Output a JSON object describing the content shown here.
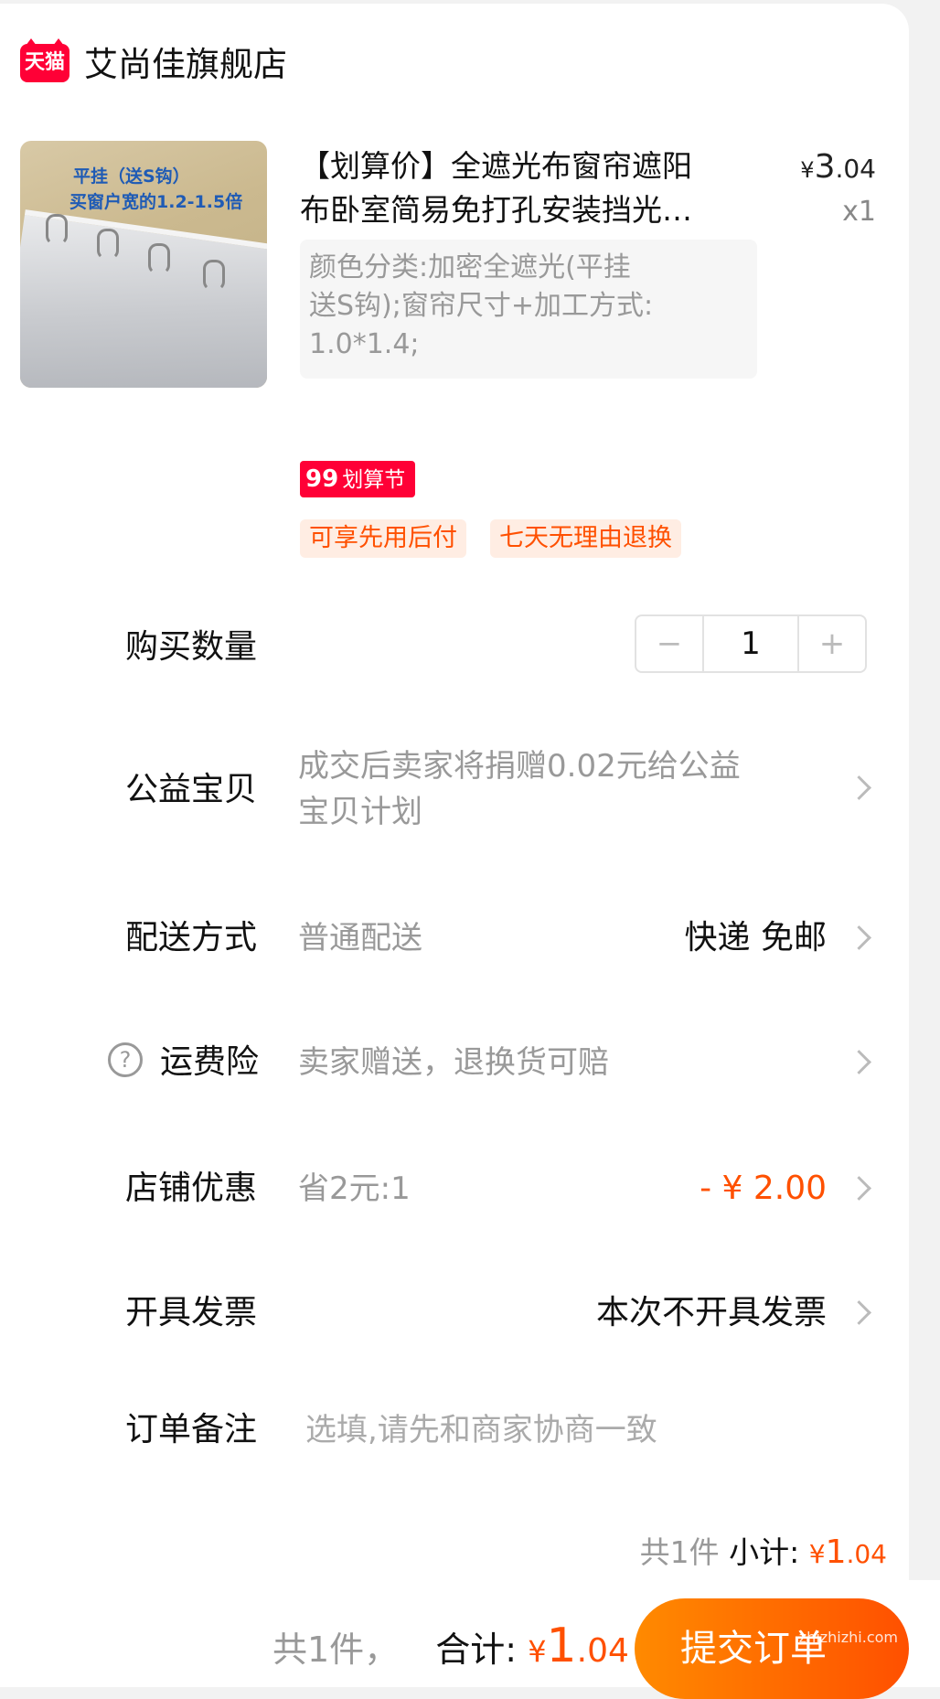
{
  "store": {
    "badge": "天猫",
    "name": "艾尚佳旗舰店"
  },
  "product": {
    "title": "【划算价】全遮光布窗帘遮阳",
    "title_line2": "布卧室简易免打孔安装挡光…",
    "price_symbol": "¥",
    "price_int": "3",
    "price_dec": ".04",
    "quantity_text": "x1",
    "sku_lines": [
      "颜色分类:加密全遮光(平挂",
      "送S钩);窗帘尺寸+加工方式:",
      "1.0*1.4;"
    ],
    "thumb_text_1": "平挂（送S钩）",
    "thumb_text_2": "买窗户宽的1.2-1.5倍",
    "promo_num": "99",
    "promo_text": "划算节",
    "tags": [
      "可享先用后付",
      "七天无理由退换"
    ]
  },
  "rows": {
    "quantity": {
      "label": "购买数量",
      "value": "1",
      "minus": "−",
      "plus": "+"
    },
    "charity": {
      "label": "公益宝贝",
      "line1": "成交后卖家将捐赠0.02元给公益",
      "line2": "宝贝计划"
    },
    "shipping": {
      "label": "配送方式",
      "sub": "普通配送",
      "value": "快递 免邮"
    },
    "insurance": {
      "label": "运费险",
      "sub": "卖家赠送，退换货可赔",
      "icon": "?"
    },
    "store_discount": {
      "label": "店铺优惠",
      "sub": "省2元:1",
      "value": "- ¥ 2.00"
    },
    "invoice": {
      "label": "开具发票",
      "value": "本次不开具发票"
    },
    "note": {
      "label": "订单备注",
      "placeholder": "选填,请先和商家协商一致"
    }
  },
  "subtotal": {
    "count": "共1件",
    "label": "小计:",
    "symbol": "¥",
    "int": "1",
    "dec": ".04"
  },
  "footer": {
    "count": "共1件，",
    "label": "合计:",
    "symbol": "¥",
    "int": "1",
    "dec": ".04",
    "submit": "提交订单",
    "watermark": "zhizhizhi.com"
  },
  "colors": {
    "accent": "#ff5000",
    "tmall_red": "#ff0036"
  }
}
